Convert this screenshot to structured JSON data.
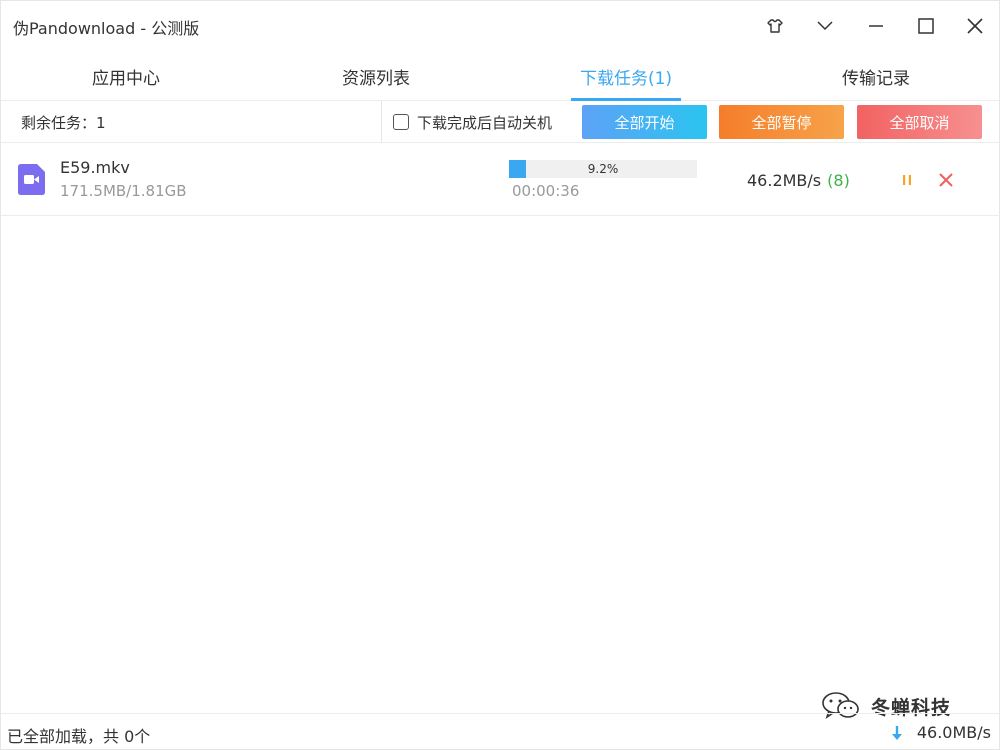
{
  "window": {
    "title": "伪Pandownload - 公测版"
  },
  "tabs": [
    {
      "label": "应用中心",
      "active": false
    },
    {
      "label": "资源列表",
      "active": false
    },
    {
      "label": "下载任务(1)",
      "active": true
    },
    {
      "label": "传输记录",
      "active": false
    }
  ],
  "toolbar": {
    "remaining_label": "剩余任务：1",
    "auto_shutdown_label": "下载完成后自动关机",
    "auto_shutdown_checked": false,
    "start_all": "全部开始",
    "pause_all": "全部暂停",
    "cancel_all": "全部取消"
  },
  "tasks": [
    {
      "icon": "video-file-icon",
      "name": "E59.mkv",
      "size": "171.5MB/1.81GB",
      "progress_label": "9.2%",
      "progress_fraction": 0.092,
      "elapsed": "00:00:36",
      "speed": "46.2MB/s",
      "connections": "(8)"
    }
  ],
  "watermark": {
    "text": "冬蝉科技"
  },
  "statusbar": {
    "text": "已全部加载，共 0个",
    "speed": "46.0MB/s"
  },
  "colors": {
    "accent": "#3aa8f0",
    "start_gradient": [
      "#5da2f7",
      "#2bc4f0"
    ],
    "pause_gradient": [
      "#f57d2b",
      "#f7a34a"
    ],
    "cancel_gradient": [
      "#f26262",
      "#f79090"
    ],
    "video_icon": "#7b6cf0",
    "connections": "#3cb34a"
  }
}
